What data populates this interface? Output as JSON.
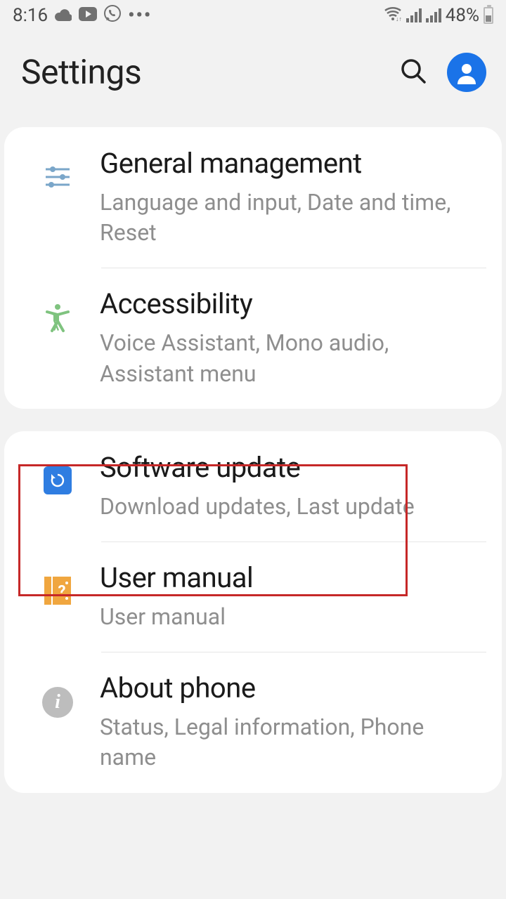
{
  "status": {
    "time": "8:16",
    "battery_pct": "48%"
  },
  "header": {
    "title": "Settings"
  },
  "group1": [
    {
      "title": "General management",
      "sub": "Language and input, Date and time, Reset"
    },
    {
      "title": "Accessibility",
      "sub": "Voice Assistant, Mono audio, Assistant menu"
    }
  ],
  "group2": [
    {
      "title": "Software update",
      "sub": "Download updates, Last update"
    },
    {
      "title": "User manual",
      "sub": "User manual"
    },
    {
      "title": "About phone",
      "sub": "Status, Legal information, Phone name"
    }
  ]
}
